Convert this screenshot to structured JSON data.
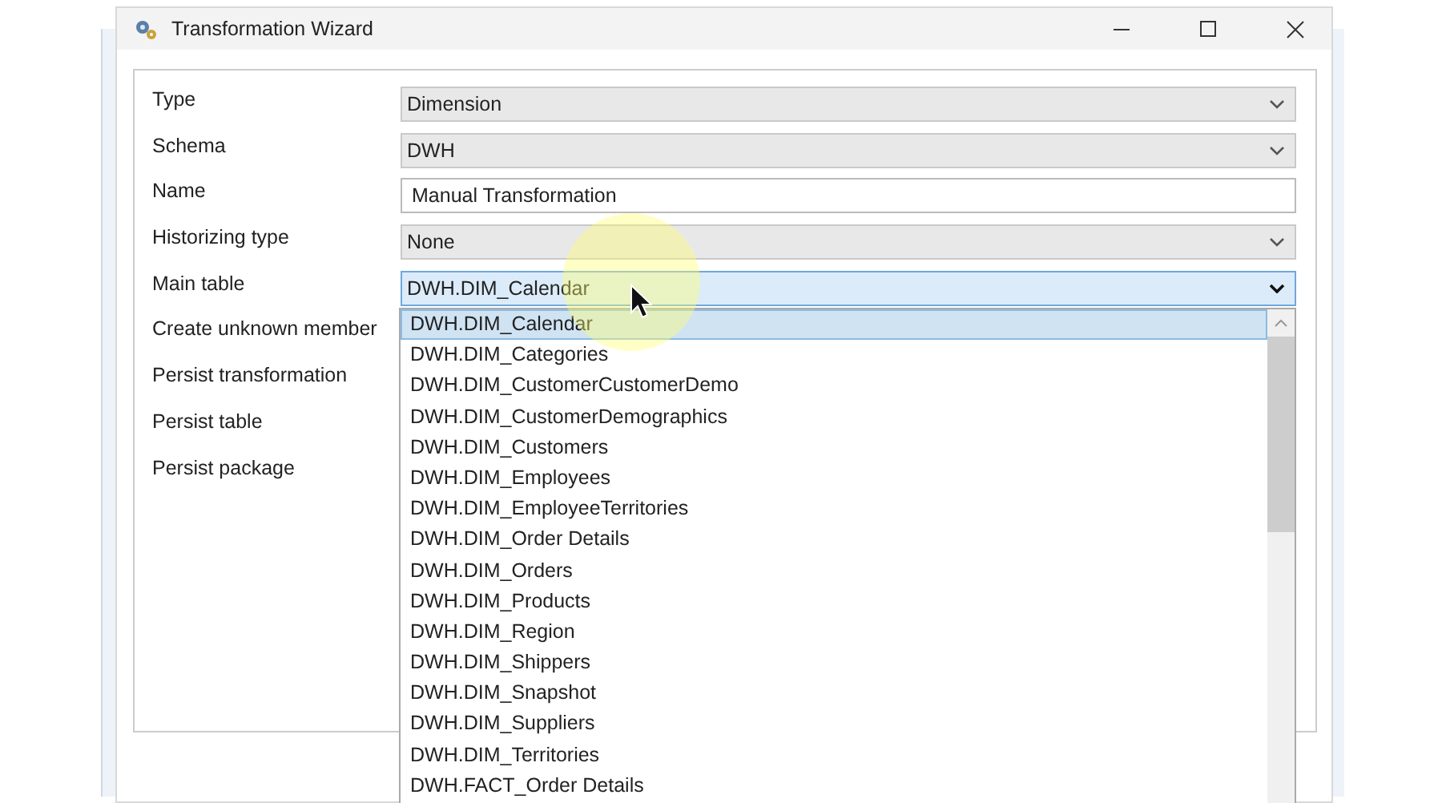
{
  "window": {
    "title": "Transformation Wizard"
  },
  "fields": [
    {
      "label": "Type",
      "kind": "dropdown",
      "value": "Dimension",
      "open": false
    },
    {
      "label": "Schema",
      "kind": "dropdown",
      "value": "DWH",
      "open": false
    },
    {
      "label": "Name",
      "kind": "text",
      "value": "Manual Transformation"
    },
    {
      "label": "Historizing type",
      "kind": "dropdown",
      "value": "None",
      "open": false
    },
    {
      "label": "Main table",
      "kind": "dropdown",
      "value": "DWH.DIM_Calendar",
      "open": true
    },
    {
      "label": "Create unknown member",
      "kind": "hidden"
    },
    {
      "label": "Persist transformation",
      "kind": "hidden"
    },
    {
      "label": "Persist table",
      "kind": "hidden"
    },
    {
      "label": "Persist package",
      "kind": "hidden"
    }
  ],
  "dropdown_list": {
    "items": [
      {
        "label": "DWH.DIM_Calendar",
        "selected": true
      },
      {
        "label": "DWH.DIM_Categories",
        "selected": false
      },
      {
        "label": "DWH.DIM_CustomerCustomerDemo",
        "selected": false
      },
      {
        "label": "DWH.DIM_CustomerDemographics",
        "selected": false
      },
      {
        "label": "DWH.DIM_Customers",
        "selected": false
      },
      {
        "label": "DWH.DIM_Employees",
        "selected": false
      },
      {
        "label": "DWH.DIM_EmployeeTerritories",
        "selected": false
      },
      {
        "label": "DWH.DIM_Order Details",
        "selected": false
      },
      {
        "label": "DWH.DIM_Orders",
        "selected": false
      },
      {
        "label": "DWH.DIM_Products",
        "selected": false
      },
      {
        "label": "DWH.DIM_Region",
        "selected": false
      },
      {
        "label": "DWH.DIM_Shippers",
        "selected": false
      },
      {
        "label": "DWH.DIM_Snapshot",
        "selected": false
      },
      {
        "label": "DWH.DIM_Suppliers",
        "selected": false
      },
      {
        "label": "DWH.DIM_Territories",
        "selected": false
      },
      {
        "label": "DWH.FACT_Order Details",
        "selected": false
      }
    ]
  }
}
